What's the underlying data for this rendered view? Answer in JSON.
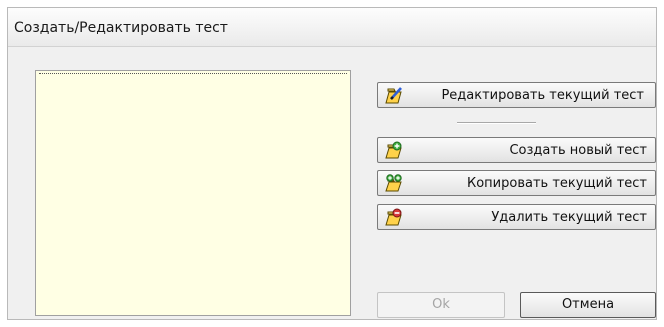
{
  "window": {
    "title": "Создать/Редактировать тест"
  },
  "actions": {
    "edit_label": "Редактировать текущий тест",
    "create_label": "Создать новый тест",
    "copy_label": "Копировать текущий тест",
    "delete_label": "Удалить текущий тест"
  },
  "footer": {
    "ok_label": "Ok",
    "cancel_label": "Отмена"
  },
  "colors": {
    "list_background": "#ffffe4",
    "dialog_background": "#f0f0f0",
    "disabled_text": "#a5a5a5"
  },
  "icons": {
    "edit": "document-edit-icon",
    "create": "document-add-icon",
    "copy": "document-copy-icon",
    "delete": "document-delete-icon"
  },
  "state": {
    "ok_enabled": false
  }
}
